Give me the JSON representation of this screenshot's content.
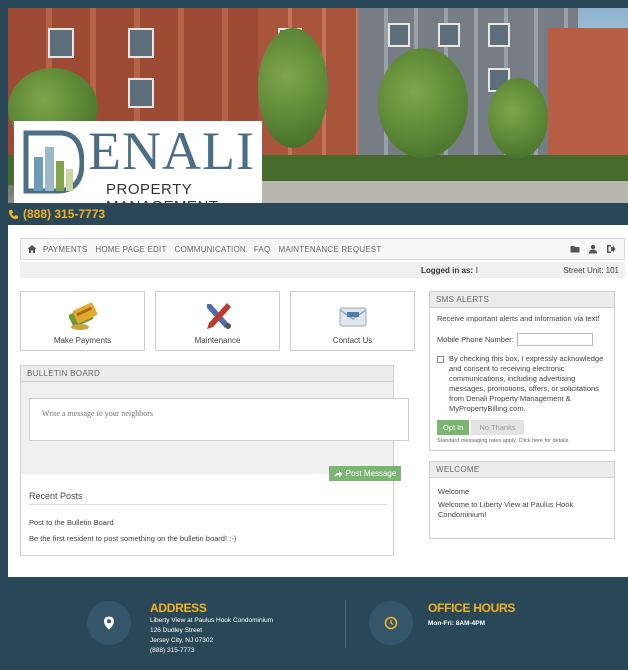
{
  "banner": {
    "logo_name": "ENALI",
    "logo_subtitle": "PROPERTY MANAGEMENT"
  },
  "phone_strip": {
    "phone": "(888) 315-7773"
  },
  "nav": {
    "items": [
      "PAYMENTS",
      "HOME PAGE EDIT",
      "COMMUNICATION",
      "FAQ",
      "MAINTENANCE REQUEST"
    ],
    "right_icons": [
      "folder-icon",
      "user-icon",
      "logout-icon"
    ]
  },
  "login": {
    "label": "Logged in as:",
    "user": "l",
    "unit": "Street Unit: 101"
  },
  "tiles": [
    {
      "label": "Make Payments",
      "icon": "payment-icon"
    },
    {
      "label": "Maintenance",
      "icon": "tools-icon"
    },
    {
      "label": "Contact Us",
      "icon": "mail-icon"
    }
  ],
  "bulletin": {
    "title": "BULLETIN BOARD",
    "placeholder": "Write a message to your neighbors",
    "post_button": "Post Message",
    "recent_heading": "Recent Posts",
    "post_line_1": "Post to the Bulletin Board",
    "post_line_2": "Be the first resident to post something on the bulletin board! :-)"
  },
  "sms": {
    "title": "SMS ALERTS",
    "intro": "Receive important alerts and information via text!",
    "phone_label": "Mobile Phone Number:",
    "consent": "By checking this box, I expressly acknowledge and consent to receiving electronic communications, including advertising messages, promotions, offers, or solicitations from Denali Property Management & MyPropertyBilling.com.",
    "opt_in": "Opt In",
    "no_thanks": "No Thanks",
    "fine_print": "Standard messaging rates apply. Click here for details."
  },
  "welcome": {
    "title": "WELCOME",
    "heading": "Welcome",
    "body": "Welcome to Liberty View at Paulus Hook Condominium!"
  },
  "footer": {
    "address_title": "ADDRESS",
    "address_line_1": "Liberty View at Paulus Hook Condominium",
    "address_line_2": "126 Dudley Street",
    "address_line_3": "Jersey City, NJ 07302",
    "address_line_4": "(888) 315-7773",
    "hours_title": "OFFICE HOURS",
    "hours_text": "Mon-Fri: 8AM-4PM"
  },
  "colors": {
    "accent_gold": "#f0b323",
    "footer_bg": "#2a4757",
    "button_green": "#7bb572",
    "logo_blue": "#4b6e86"
  }
}
